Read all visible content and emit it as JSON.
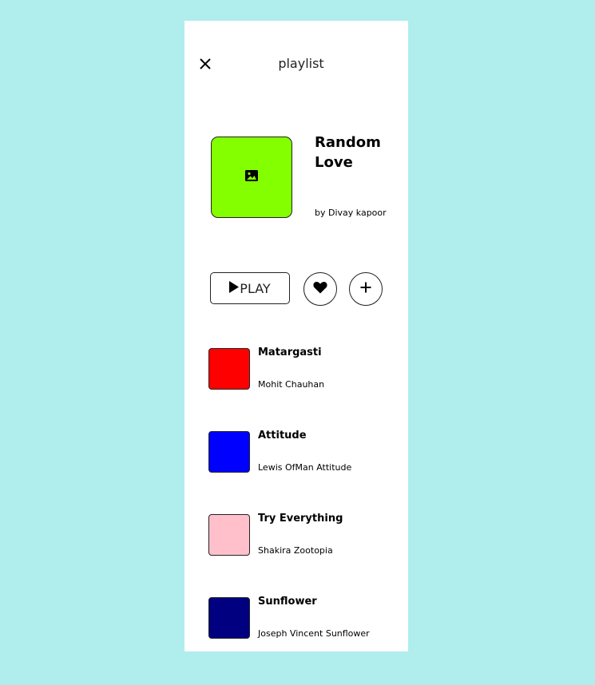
{
  "header": {
    "close_icon": "close-icon",
    "title": "playlist"
  },
  "playlist": {
    "name": "Random Love",
    "author": "by Divay kapoor",
    "cover_color": "#84ff00",
    "cover_icon": "image-icon"
  },
  "actions": {
    "play_label": "PLAY",
    "play_icon": "play-icon",
    "like_icon": "heart-icon",
    "add_icon": "plus-icon"
  },
  "tracks": [
    {
      "title": "Matargasti",
      "artist": "Mohit Chauhan",
      "color": "#ff0000"
    },
    {
      "title": "Attitude",
      "artist": "Lewis OfMan Attitude",
      "color": "#0000ff"
    },
    {
      "title": "Try Everything",
      "artist": "Shakira Zootopia",
      "color": "#ffc0cb"
    },
    {
      "title": "Sunflower",
      "artist": "Joseph Vincent Sunflower",
      "color": "#000080"
    }
  ]
}
